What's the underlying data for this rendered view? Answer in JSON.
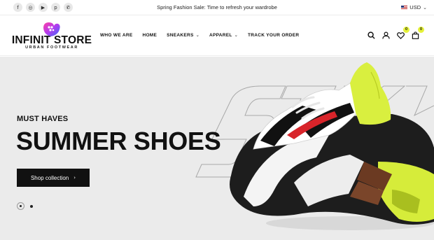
{
  "topbar": {
    "socials": [
      {
        "name": "facebook-icon",
        "glyph": "f"
      },
      {
        "name": "instagram-icon",
        "glyph": "◎"
      },
      {
        "name": "youtube-icon",
        "glyph": "▶"
      },
      {
        "name": "pinterest-icon",
        "glyph": "p"
      },
      {
        "name": "whatsapp-icon",
        "glyph": "✆"
      }
    ],
    "promo": "Spring Fashion Sale: Time to refresh your wardrobe",
    "currency": "USD"
  },
  "header": {
    "logo_title": "INFINIT STORE",
    "logo_subtitle": "URBAN FOOTWEAR",
    "nav": [
      {
        "label": "WHO WE ARE",
        "dropdown": false
      },
      {
        "label": "HOME",
        "dropdown": false
      },
      {
        "label": "SNEAKERS",
        "dropdown": true
      },
      {
        "label": "APPAREL",
        "dropdown": true
      },
      {
        "label": "TRACK YOUR ORDER",
        "dropdown": false
      }
    ],
    "wishlist_count": "0",
    "cart_count": "0"
  },
  "hero": {
    "eyebrow": "MUST HAVES",
    "headline": "SUMMER SHOES",
    "cta_label": "Shop collection",
    "slides": 2,
    "active_slide": 1
  },
  "colors": {
    "accent": "#e6f23a",
    "hero_bg": "#ebebeb",
    "text": "#111111"
  }
}
